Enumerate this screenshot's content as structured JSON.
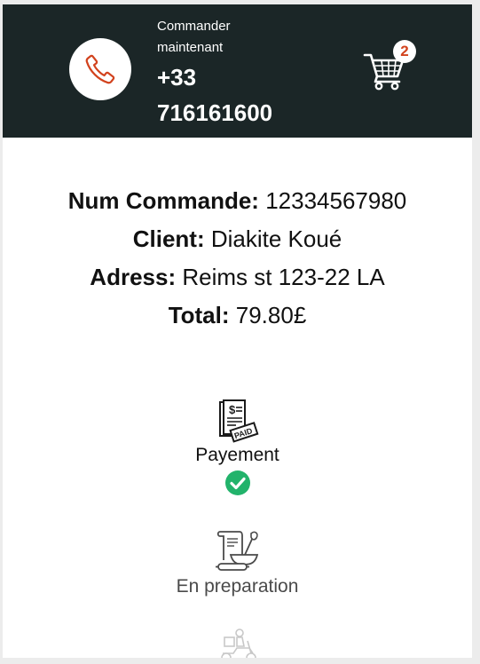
{
  "header": {
    "call_label": "Commander maintenant",
    "phone_number": "+33 716161600",
    "phone_icon": "phone-icon",
    "cart_icon": "shopping-cart-icon",
    "cart_count": "2",
    "colors": {
      "bar_background": "#1b2627",
      "accent": "#d2431e"
    }
  },
  "order": {
    "number_label": "Num Commande:",
    "number_value": "12334567980",
    "client_label": "Client:",
    "client_value": "Diakite Koué",
    "address_label": "Adress:",
    "address_value": "Reims st 123-22 LA",
    "total_label": "Total:",
    "total_value": "79.80£"
  },
  "steps": [
    {
      "label": "Payement",
      "icon": "paid-invoice-icon",
      "status_icon": "check-circle-icon",
      "done": true
    },
    {
      "label": "En preparation",
      "icon": "cooking-preparation-icon",
      "done": false
    },
    {
      "label": "",
      "icon": "delivery-scooter-icon",
      "done": false
    }
  ]
}
